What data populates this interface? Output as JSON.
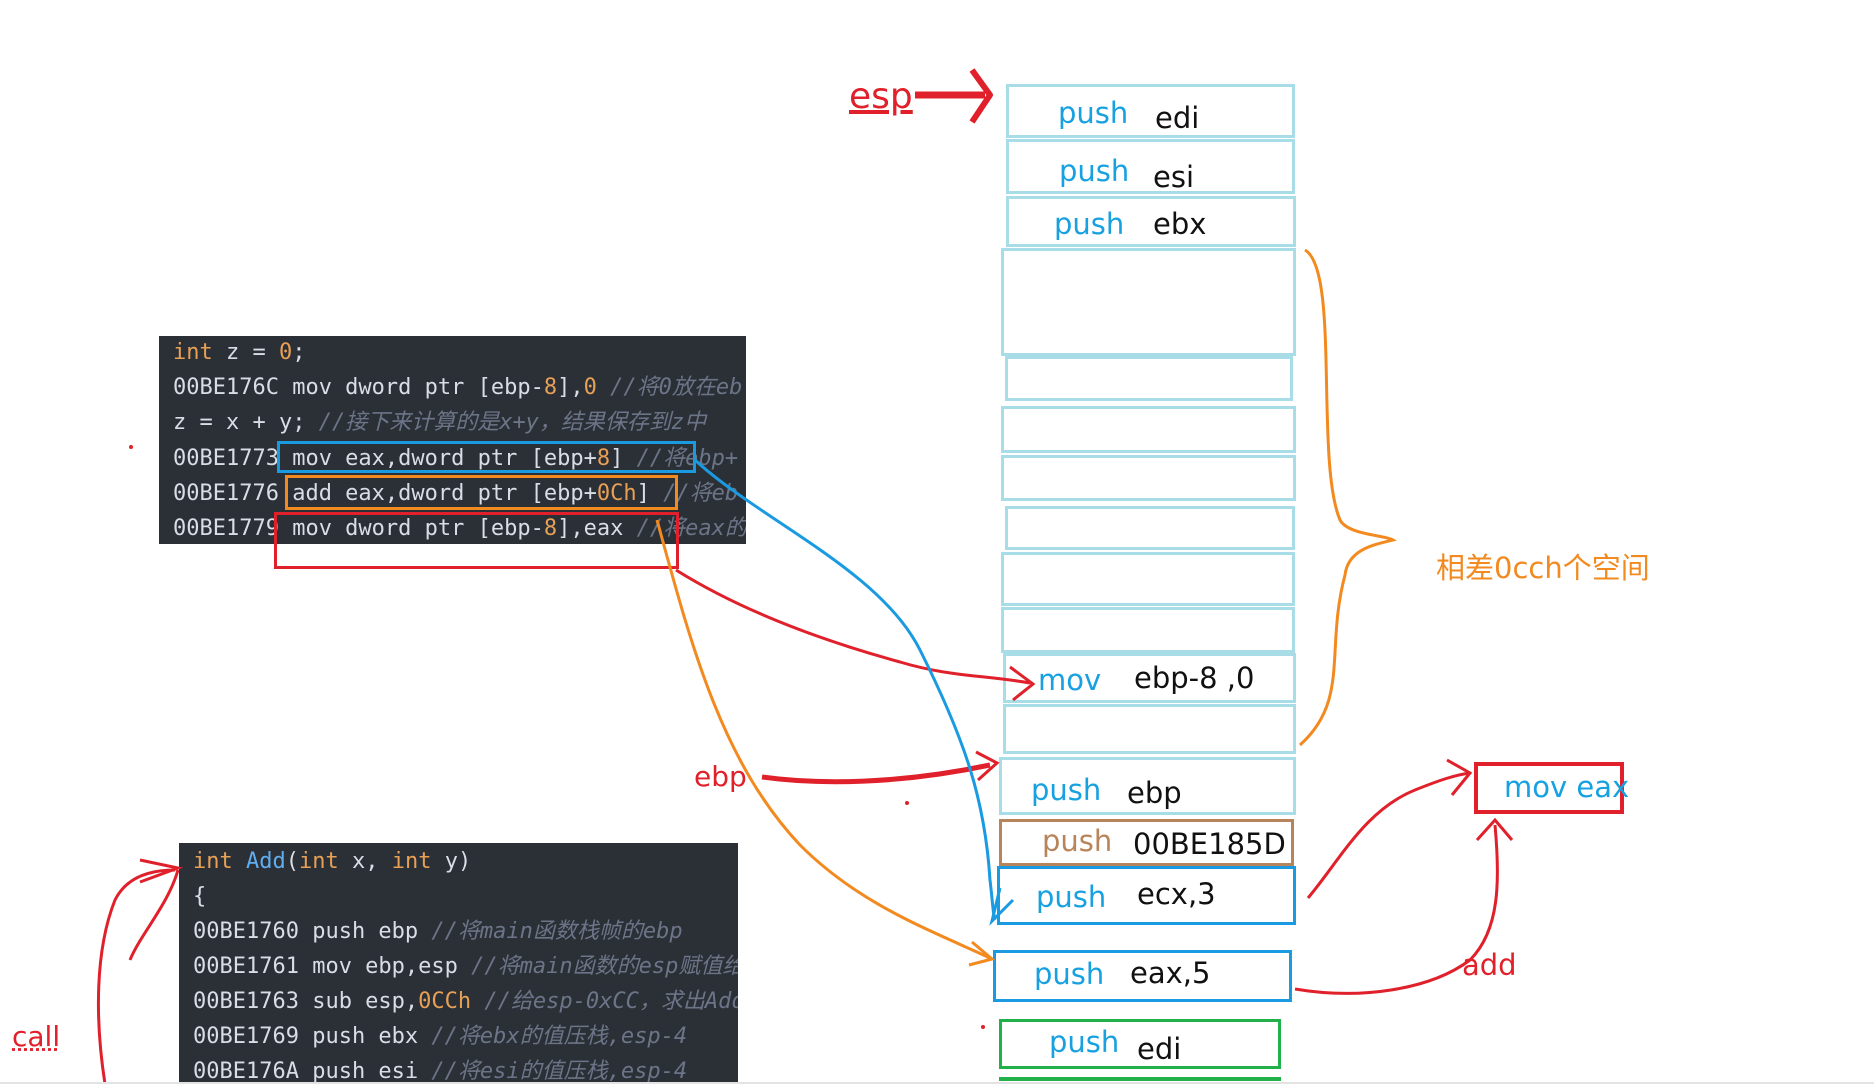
{
  "code_top": {
    "lines": [
      [
        {
          "t": "int",
          "c": "kw"
        },
        {
          "t": " z = ",
          "c": ""
        },
        {
          "t": "0",
          "c": "num"
        },
        {
          "t": ";",
          "c": ""
        }
      ],
      [
        {
          "t": "00BE176C mov dword ptr [ebp-",
          "c": ""
        },
        {
          "t": "8",
          "c": "num"
        },
        {
          "t": "],",
          "c": ""
        },
        {
          "t": "0",
          "c": "num"
        },
        {
          "t": " //将0放在eb",
          "c": "cm"
        }
      ],
      [
        {
          "t": "z = x + y;    ",
          "c": ""
        },
        {
          "t": "//接下来计算的是x+y，结果保存到z中",
          "c": "cm"
        }
      ],
      [
        {
          "t": "00BE1773 mov eax,dword ptr [ebp+",
          "c": ""
        },
        {
          "t": "8",
          "c": "num"
        },
        {
          "t": "] ",
          "c": ""
        },
        {
          "t": "//将ebp+",
          "c": "cm"
        }
      ],
      [
        {
          "t": "00BE1776 add eax,dword ptr [ebp+",
          "c": ""
        },
        {
          "t": "0Ch",
          "c": "num"
        },
        {
          "t": "] ",
          "c": ""
        },
        {
          "t": "//将eb",
          "c": "cm"
        }
      ],
      [
        {
          "t": "00BE1779 mov dword ptr [ebp-",
          "c": ""
        },
        {
          "t": "8",
          "c": "num"
        },
        {
          "t": "],eax ",
          "c": ""
        },
        {
          "t": "//将eax的",
          "c": "cm"
        }
      ]
    ]
  },
  "code_bottom": {
    "lines": [
      [
        {
          "t": "int",
          "c": "kw"
        },
        {
          "t": " ",
          "c": ""
        },
        {
          "t": "Add",
          "c": "fn"
        },
        {
          "t": "(",
          "c": ""
        },
        {
          "t": "int",
          "c": "kw"
        },
        {
          "t": " x, ",
          "c": ""
        },
        {
          "t": "int",
          "c": "kw"
        },
        {
          "t": " y)",
          "c": ""
        }
      ],
      [
        {
          "t": "{",
          "c": ""
        }
      ],
      [
        {
          "t": "00BE1760 push ebp     ",
          "c": ""
        },
        {
          "t": "//将main函数栈帧的ebp",
          "c": "cm"
        }
      ],
      [
        {
          "t": "00BE1761 mov ebp,esp ",
          "c": ""
        },
        {
          "t": "//将main函数的esp赋值给",
          "c": "cm"
        }
      ],
      [
        {
          "t": "00BE1763 sub esp,",
          "c": ""
        },
        {
          "t": "0CCh",
          "c": "num"
        },
        {
          "t": " ",
          "c": ""
        },
        {
          "t": "//给esp-0xCC，求出Add",
          "c": "cm"
        }
      ],
      [
        {
          "t": "00BE1769 push ebx ",
          "c": ""
        },
        {
          "t": "//将ebx的值压栈,esp-4",
          "c": "cm"
        }
      ],
      [
        {
          "t": "00BE176A push esi ",
          "c": ""
        },
        {
          "t": "//将esi的值压栈,esp-4",
          "c": "cm"
        }
      ]
    ]
  },
  "stack": {
    "rows": [
      {
        "op": "push",
        "arg": "edi"
      },
      {
        "op": "push",
        "arg": "esi"
      },
      {
        "op": "push",
        "arg": "ebx"
      },
      {
        "op": "mov",
        "arg": "ebp-8 ,0"
      },
      {
        "op": "push",
        "arg": "ebp"
      },
      {
        "op": "push",
        "arg": "00BE185D"
      },
      {
        "op": "push",
        "arg": "ecx,3"
      },
      {
        "op": "push",
        "arg": "eax,5"
      },
      {
        "op": "push",
        "arg": "edi"
      }
    ]
  },
  "labels": {
    "esp": "esp",
    "ebp": "ebp",
    "call": "call",
    "add": "add",
    "mov_eax": "mov eax",
    "gap_note": "相差0cch个空间"
  },
  "colors": {
    "red": "#e0202a",
    "orange": "#f28a20",
    "blue": "#1a9ae0",
    "cyan": "#a8dde8",
    "brown": "#b8845a",
    "green": "#22b04a",
    "code_bg": "#2b2f36"
  }
}
